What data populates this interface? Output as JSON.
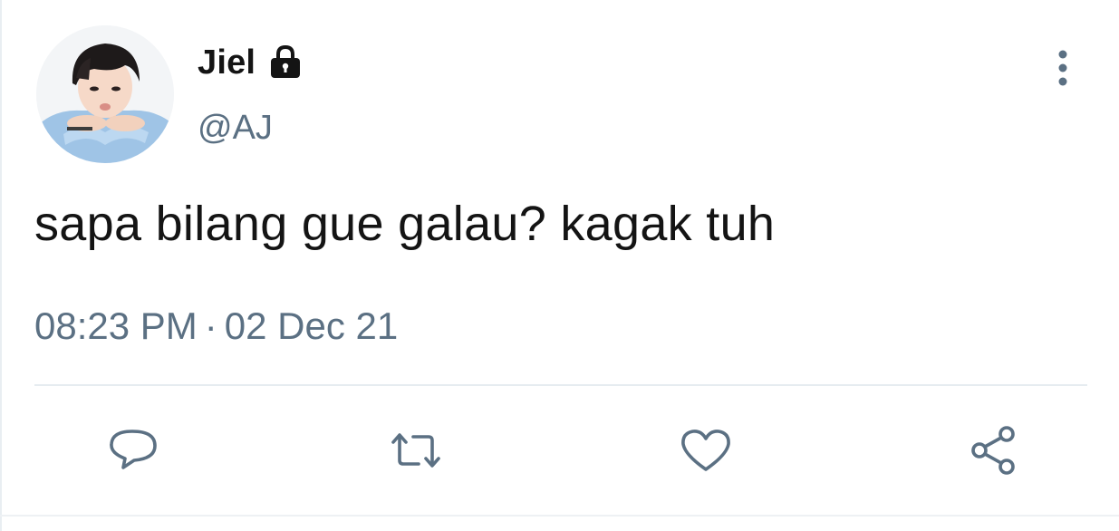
{
  "tweet": {
    "author": {
      "display_name": "Jiel",
      "handle": "@AJ",
      "protected_icon": "lock-icon",
      "avatar": "profile-photo"
    },
    "text": "sapa bilang gue galau? kagak tuh",
    "time": "08:23 PM",
    "separator": "·",
    "date": "02 Dec 21"
  },
  "actions": [
    {
      "name": "reply",
      "icon": "reply-icon"
    },
    {
      "name": "retweet",
      "icon": "retweet-icon"
    },
    {
      "name": "like",
      "icon": "heart-icon"
    },
    {
      "name": "share",
      "icon": "share-icon"
    }
  ],
  "menu": {
    "icon": "more-vertical-icon"
  },
  "colors": {
    "text_primary": "#141414",
    "text_secondary": "#5b7083",
    "divider": "#e6ecf0"
  }
}
